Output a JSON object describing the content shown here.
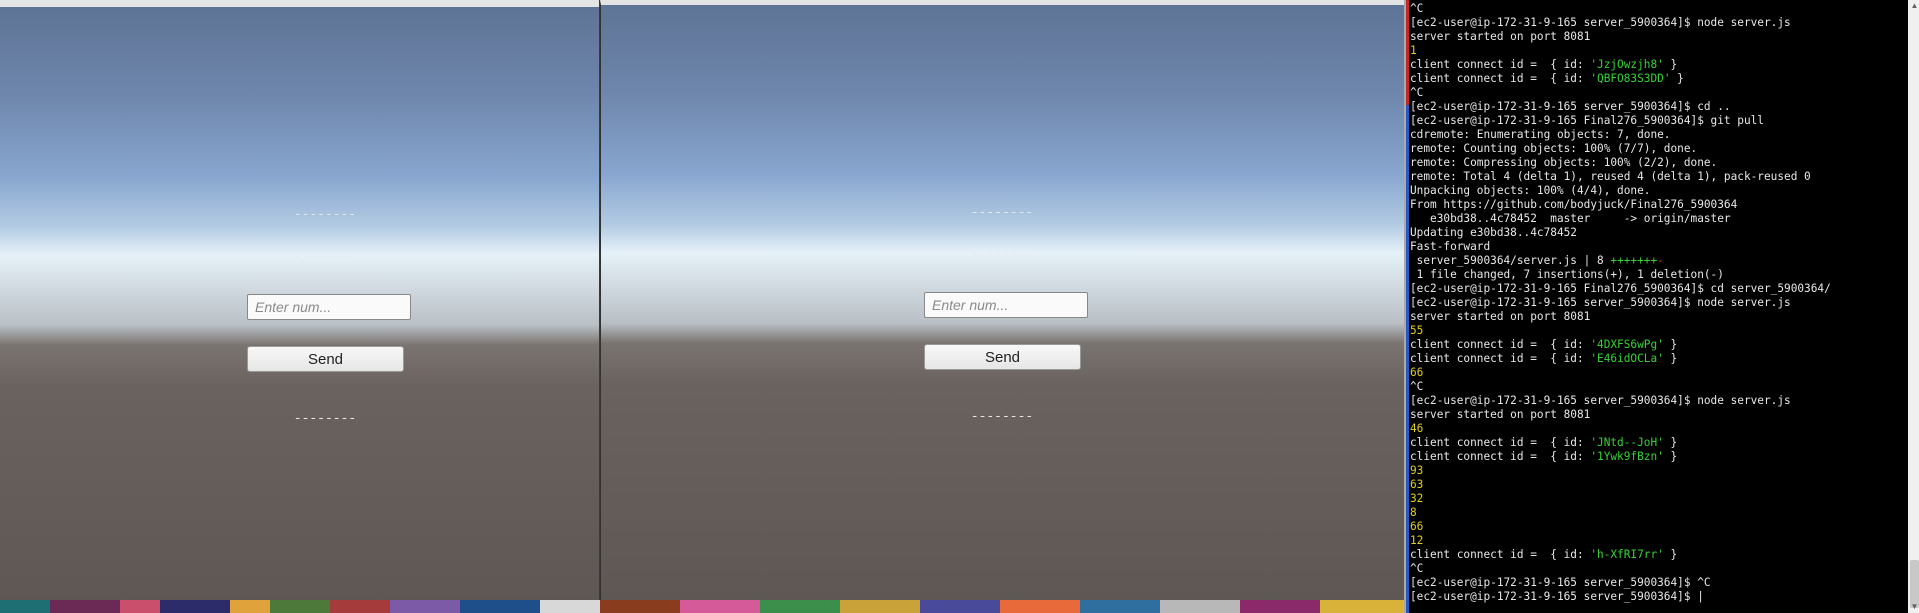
{
  "left_view": {
    "dash_top": "--------",
    "dash_mid": "--------",
    "input_placeholder": "Enter num...",
    "send_label": "Send",
    "dash_bottom": "--------"
  },
  "right_view": {
    "dash_top": "--------",
    "dash_mid": "--------",
    "input_placeholder": "Enter num...",
    "send_label": "Send",
    "dash_bottom": "--------"
  },
  "terminal": {
    "lines": [
      {
        "text": "^C",
        "color": "default"
      },
      {
        "text": "[ec2-user@ip-172-31-9-165 server_5900364]$ node server.js",
        "color": "default"
      },
      {
        "text": "server started on port 8081",
        "color": "default"
      },
      {
        "text": "1",
        "color": "yellow"
      },
      {
        "text": "client connect id =  { id: 'JzjOwzjh8' }",
        "color": "id",
        "id": "'JzjOwzjh8'"
      },
      {
        "text": "client connect id =  { id: 'QBFO83S3DD' }",
        "color": "id",
        "id": "'QBFO83S3DD'"
      },
      {
        "text": "^C",
        "color": "default"
      },
      {
        "text": "[ec2-user@ip-172-31-9-165 server_5900364]$ cd ..",
        "color": "default"
      },
      {
        "text": "[ec2-user@ip-172-31-9-165 Final276_5900364]$ git pull",
        "color": "default"
      },
      {
        "text": "cdremote: Enumerating objects: 7, done.",
        "color": "default"
      },
      {
        "text": "remote: Counting objects: 100% (7/7), done.",
        "color": "default"
      },
      {
        "text": "remote: Compressing objects: 100% (2/2), done.",
        "color": "default"
      },
      {
        "text": "remote: Total 4 (delta 1), reused 4 (delta 1), pack-reused 0",
        "color": "default"
      },
      {
        "text": "Unpacking objects: 100% (4/4), done.",
        "color": "default"
      },
      {
        "text": "From https://github.com/bodyjuck/Final276_5900364",
        "color": "default"
      },
      {
        "text": "   e30bd38..4c78452  master     -> origin/master",
        "color": "default"
      },
      {
        "text": "Updating e30bd38..4c78452",
        "color": "default"
      },
      {
        "text": "Fast-forward",
        "color": "default"
      },
      {
        "text": " server_5900364/server.js | 8 +++++++-",
        "color": "diff"
      },
      {
        "text": " 1 file changed, 7 insertions(+), 1 deletion(-)",
        "color": "default"
      },
      {
        "text": "[ec2-user@ip-172-31-9-165 Final276_5900364]$ cd server_5900364/",
        "color": "default"
      },
      {
        "text": "[ec2-user@ip-172-31-9-165 server_5900364]$ node server.js",
        "color": "default"
      },
      {
        "text": "server started on port 8081",
        "color": "default"
      },
      {
        "text": "55",
        "color": "yellow"
      },
      {
        "text": "client connect id =  { id: '4DXFS6wPg' }",
        "color": "id",
        "id": "'4DXFS6wPg'"
      },
      {
        "text": "client connect id =  { id: 'E46idOCLa' }",
        "color": "id",
        "id": "'E46idOCLa'"
      },
      {
        "text": "66",
        "color": "yellow"
      },
      {
        "text": "^C",
        "color": "default"
      },
      {
        "text": "[ec2-user@ip-172-31-9-165 server_5900364]$ node server.js",
        "color": "default"
      },
      {
        "text": "server started on port 8081",
        "color": "default"
      },
      {
        "text": "46",
        "color": "yellow"
      },
      {
        "text": "client connect id =  { id: 'JNtd--JoH' }",
        "color": "id",
        "id": "'JNtd--JoH'"
      },
      {
        "text": "client connect id =  { id: '1Ywk9fBzn' }",
        "color": "id",
        "id": "'1Ywk9fBzn'"
      },
      {
        "text": "93",
        "color": "yellow"
      },
      {
        "text": "63",
        "color": "yellow"
      },
      {
        "text": "32",
        "color": "yellow"
      },
      {
        "text": "8",
        "color": "yellow"
      },
      {
        "text": "66",
        "color": "yellow"
      },
      {
        "text": "12",
        "color": "yellow"
      },
      {
        "text": "client connect id =  { id: 'h-XfRI7rr' }",
        "color": "id",
        "id": "'h-XfRI7rr'"
      },
      {
        "text": "^C",
        "color": "default"
      },
      {
        "text": "[ec2-user@ip-172-31-9-165 server_5900364]$ ^C",
        "color": "default"
      },
      {
        "text": "[ec2-user@ip-172-31-9-165 server_5900364]$ |",
        "color": "default"
      }
    ]
  },
  "colors": {
    "terminal_bg": "#000000",
    "terminal_text": "#e8e8e8",
    "number_yellow": "#e0d020",
    "id_green": "#36d136"
  }
}
